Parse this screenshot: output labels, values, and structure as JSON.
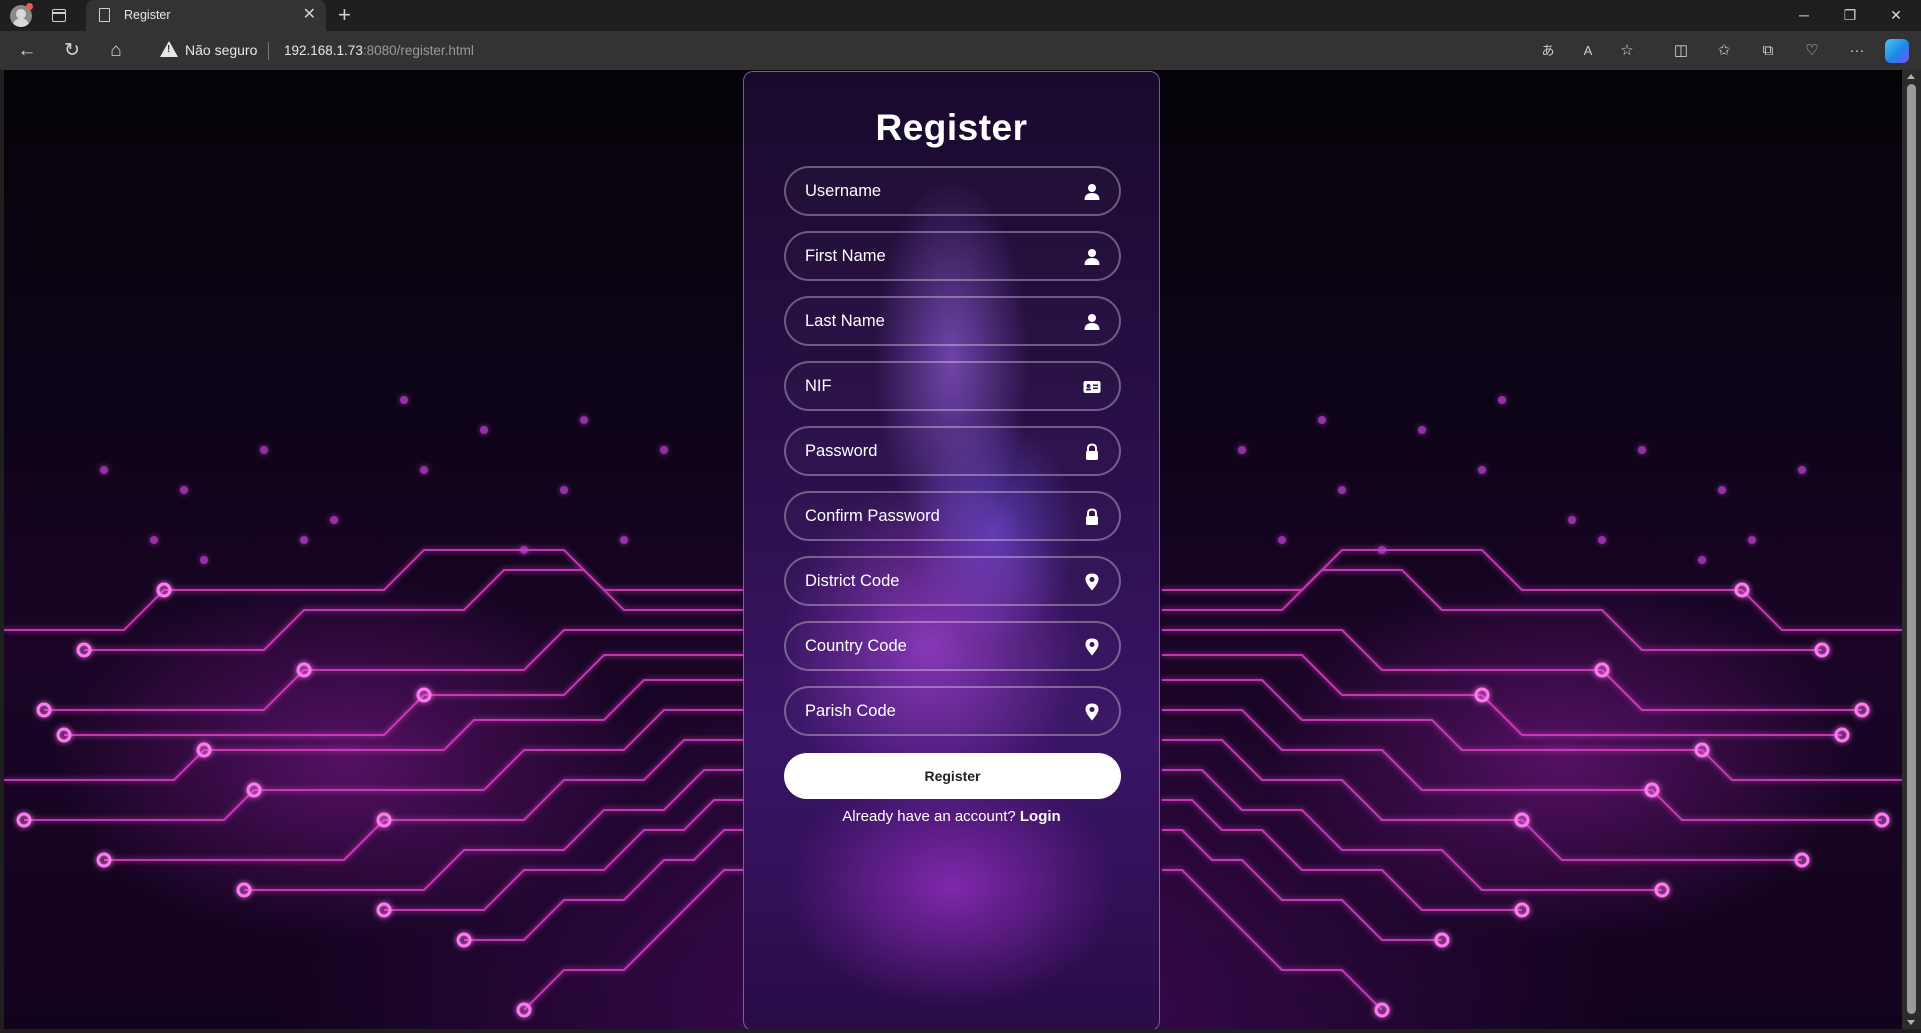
{
  "browser": {
    "tab_title": "Register",
    "tab_close": "✕",
    "new_tab": "+",
    "security_label": "Não seguro",
    "url_host": "192.168.1.73",
    "url_rest": ":8080/register.html",
    "window_controls": {
      "minimize": "─",
      "restore": "❐",
      "close": "✕"
    }
  },
  "form": {
    "title": "Register",
    "fields": [
      {
        "placeholder": "Username",
        "icon": "user-icon"
      },
      {
        "placeholder": "First Name",
        "icon": "user-icon"
      },
      {
        "placeholder": "Last Name",
        "icon": "user-icon"
      },
      {
        "placeholder": "NIF",
        "icon": "id-card-icon"
      },
      {
        "placeholder": "Password",
        "icon": "lock-icon"
      },
      {
        "placeholder": "Confirm Password",
        "icon": "lock-icon"
      },
      {
        "placeholder": "District Code",
        "icon": "location-pin-icon"
      },
      {
        "placeholder": "Country Code",
        "icon": "location-pin-icon"
      },
      {
        "placeholder": "Parish Code",
        "icon": "location-pin-icon"
      }
    ],
    "submit_label": "Register",
    "login_prompt": "Already have an account?",
    "login_link": "Login"
  },
  "colors": {
    "accent": "#c03ce0",
    "card_border": "#dcc8ff",
    "button_bg": "#ffffff"
  }
}
